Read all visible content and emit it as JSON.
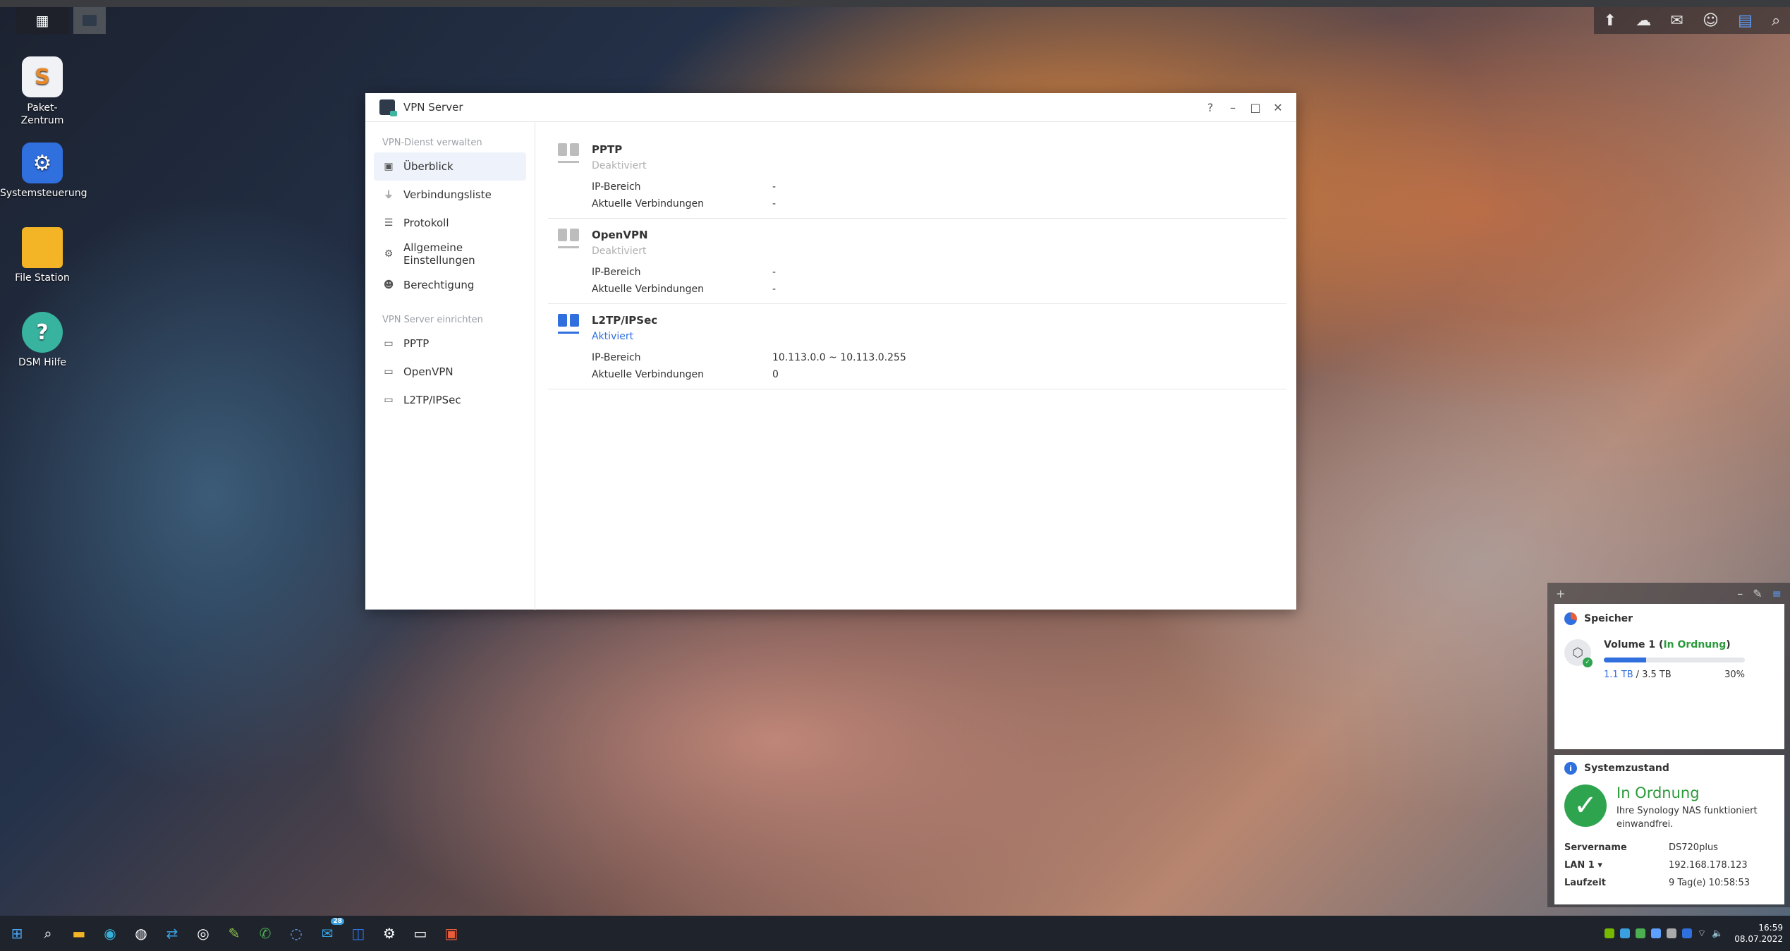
{
  "window": {
    "title": "VPN Server",
    "help": "?",
    "minimize": "–",
    "maximize": "□",
    "close": "✕"
  },
  "sidebar": {
    "section1": "VPN-Dienst verwalten",
    "section2": "VPN Server einrichten",
    "items": [
      {
        "label": "Überblick"
      },
      {
        "label": "Verbindungsliste"
      },
      {
        "label": "Protokoll"
      },
      {
        "label": "Allgemeine Einstellungen"
      },
      {
        "label": "Berechtigung"
      }
    ],
    "setup": [
      {
        "label": "PPTP"
      },
      {
        "label": "OpenVPN"
      },
      {
        "label": "L2TP/IPSec"
      }
    ]
  },
  "services": [
    {
      "name": "PPTP",
      "status": "Deaktiviert",
      "ip_label": "IP-Bereich",
      "ip": "-",
      "conn_label": "Aktuelle Verbindungen",
      "conn": "-",
      "color": "#bdbdbd"
    },
    {
      "name": "OpenVPN",
      "status": "Deaktiviert",
      "ip_label": "IP-Bereich",
      "ip": "-",
      "conn_label": "Aktuelle Verbindungen",
      "conn": "-",
      "color": "#bdbdbd"
    },
    {
      "name": "L2TP/IPSec",
      "status": "Aktiviert",
      "ip_label": "IP-Bereich",
      "ip": "10.113.0.0 ~ 10.113.0.255",
      "conn_label": "Aktuelle Verbindungen",
      "conn": "0",
      "color": "#2f6fde"
    }
  ],
  "desktop": {
    "icons": [
      {
        "label": "Paket-Zentrum"
      },
      {
        "label": "Systemsteuerung"
      },
      {
        "label": "File Station"
      },
      {
        "label": "DSM Hilfe"
      }
    ]
  },
  "widgets": {
    "storage": {
      "title": "Speicher",
      "volume": "Volume 1 (",
      "volume_status": "In Ordnung",
      "volume_end": ")",
      "used": "1.1 TB",
      "sep": "/",
      "total": "3.5 TB",
      "percent": "30%",
      "fraction": 0.3
    },
    "health": {
      "title": "Systemzustand",
      "status": "In Ordnung",
      "desc": "Ihre Synology NAS funktioniert einwandfrei.",
      "rows": [
        {
          "k": "Servername",
          "v": "DS720plus"
        },
        {
          "k": "LAN 1 ▾",
          "v": "192.168.178.123"
        },
        {
          "k": "Laufzeit",
          "v": "9 Tag(e) 10:58:53"
        }
      ]
    }
  },
  "taskbar": {
    "time": "16:59",
    "date": "08.07.2022",
    "badge": "28"
  },
  "colors": {
    "accent": "#2f6fde",
    "ok": "#2ea44f",
    "disabled": "#bdbdbd"
  }
}
